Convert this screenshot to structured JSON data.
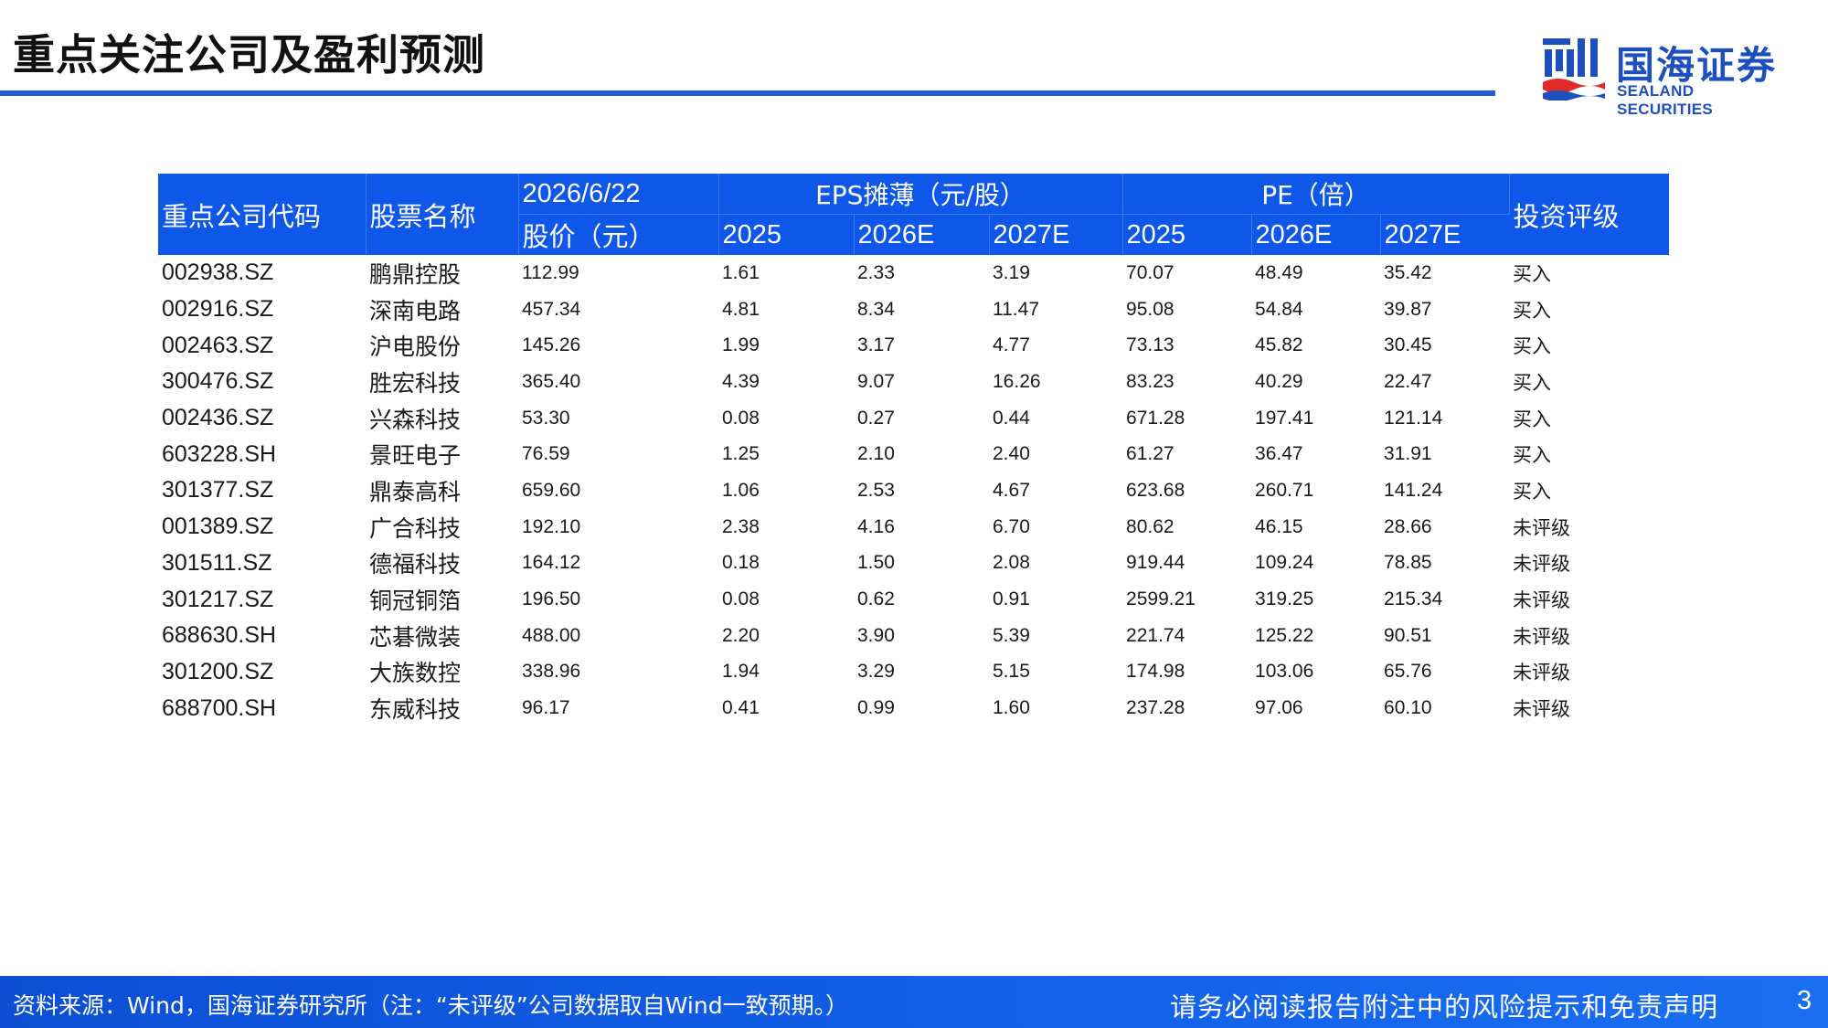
{
  "header": {
    "title": "重点关注公司及盈利预测",
    "logo_cn": "国海证券",
    "logo_en": "SEALAND SECURITIES"
  },
  "colors": {
    "accent": "#0f57e8",
    "rule": "#1e5bd8",
    "logo": "#1e4fbf",
    "logo_red": "#e02a2a"
  },
  "table": {
    "headers": {
      "code": "重点公司代码",
      "name": "股票名称",
      "date": "2026/6/22",
      "price": "股价（元）",
      "eps_group": "EPS摊薄（元/股）",
      "pe_group": "PE（倍）",
      "rating": "投资评级",
      "years": [
        "2025",
        "2026E",
        "2027E"
      ]
    },
    "rows": [
      {
        "code": "002938.SZ",
        "name": "鹏鼎控股",
        "price": "112.99",
        "eps": [
          "1.61",
          "2.33",
          "3.19"
        ],
        "pe": [
          "70.07",
          "48.49",
          "35.42"
        ],
        "rating": "买入"
      },
      {
        "code": "002916.SZ",
        "name": "深南电路",
        "price": "457.34",
        "eps": [
          "4.81",
          "8.34",
          "11.47"
        ],
        "pe": [
          "95.08",
          "54.84",
          "39.87"
        ],
        "rating": "买入"
      },
      {
        "code": "002463.SZ",
        "name": "沪电股份",
        "price": "145.26",
        "eps": [
          "1.99",
          "3.17",
          "4.77"
        ],
        "pe": [
          "73.13",
          "45.82",
          "30.45"
        ],
        "rating": "买入"
      },
      {
        "code": "300476.SZ",
        "name": "胜宏科技",
        "price": "365.40",
        "eps": [
          "4.39",
          "9.07",
          "16.26"
        ],
        "pe": [
          "83.23",
          "40.29",
          "22.47"
        ],
        "rating": "买入"
      },
      {
        "code": "002436.SZ",
        "name": "兴森科技",
        "price": "53.30",
        "eps": [
          "0.08",
          "0.27",
          "0.44"
        ],
        "pe": [
          "671.28",
          "197.41",
          "121.14"
        ],
        "rating": "买入"
      },
      {
        "code": "603228.SH",
        "name": "景旺电子",
        "price": "76.59",
        "eps": [
          "1.25",
          "2.10",
          "2.40"
        ],
        "pe": [
          "61.27",
          "36.47",
          "31.91"
        ],
        "rating": "买入"
      },
      {
        "code": "301377.SZ",
        "name": "鼎泰高科",
        "price": "659.60",
        "eps": [
          "1.06",
          "2.53",
          "4.67"
        ],
        "pe": [
          "623.68",
          "260.71",
          "141.24"
        ],
        "rating": "买入"
      },
      {
        "code": "001389.SZ",
        "name": "广合科技",
        "price": "192.10",
        "eps": [
          "2.38",
          "4.16",
          "6.70"
        ],
        "pe": [
          "80.62",
          "46.15",
          "28.66"
        ],
        "rating": "未评级"
      },
      {
        "code": "301511.SZ",
        "name": "德福科技",
        "price": "164.12",
        "eps": [
          "0.18",
          "1.50",
          "2.08"
        ],
        "pe": [
          "919.44",
          "109.24",
          "78.85"
        ],
        "rating": "未评级"
      },
      {
        "code": "301217.SZ",
        "name": "铜冠铜箔",
        "price": "196.50",
        "eps": [
          "0.08",
          "0.62",
          "0.91"
        ],
        "pe": [
          "2599.21",
          "319.25",
          "215.34"
        ],
        "rating": "未评级"
      },
      {
        "code": "688630.SH",
        "name": "芯碁微装",
        "price": "488.00",
        "eps": [
          "2.20",
          "3.90",
          "5.39"
        ],
        "pe": [
          "221.74",
          "125.22",
          "90.51"
        ],
        "rating": "未评级"
      },
      {
        "code": "301200.SZ",
        "name": "大族数控",
        "price": "338.96",
        "eps": [
          "1.94",
          "3.29",
          "5.15"
        ],
        "pe": [
          "174.98",
          "103.06",
          "65.76"
        ],
        "rating": "未评级"
      },
      {
        "code": "688700.SH",
        "name": "东威科技",
        "price": "96.17",
        "eps": [
          "0.41",
          "0.99",
          "1.60"
        ],
        "pe": [
          "237.28",
          "97.06",
          "60.10"
        ],
        "rating": "未评级"
      }
    ]
  },
  "footer": {
    "source": "资料来源：Wind，国海证券研究所（注：“未评级”公司数据取自Wind一致预期。）",
    "disclaimer": "请务必阅读报告附注中的风险提示和免责声明",
    "page": "3"
  }
}
